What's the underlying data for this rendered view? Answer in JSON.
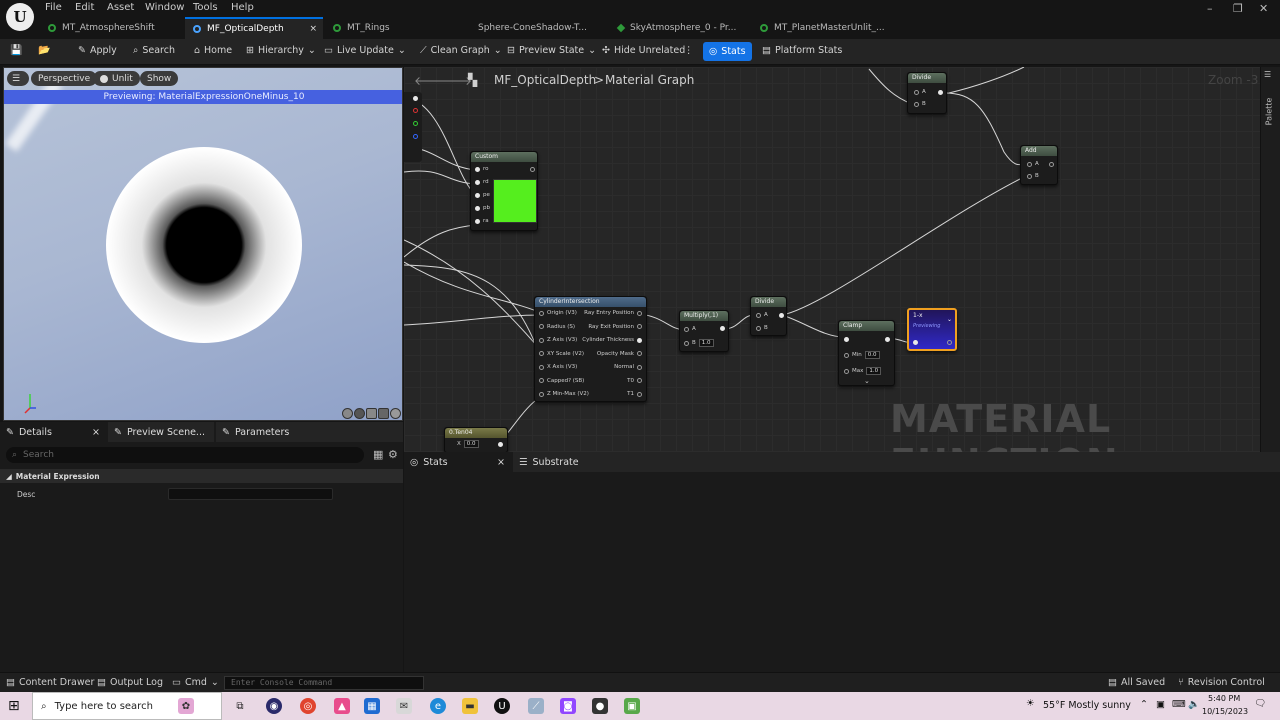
{
  "menu": {
    "items": [
      "File",
      "Edit",
      "Asset",
      "Window",
      "Tools",
      "Help"
    ]
  },
  "tabs": [
    {
      "label": "MT_AtmosphereShift"
    },
    {
      "label": "MF_OpticalDepth",
      "close": "×"
    },
    {
      "label": "MT_Rings"
    },
    {
      "label": "Sphere-ConeShadow-T..."
    },
    {
      "label": "SkyAtmosphere_0 - Pr..."
    },
    {
      "label": "MT_PlanetMasterUnlit_..."
    }
  ],
  "toolbar": {
    "apply": "Apply",
    "search": "Search",
    "home": "Home",
    "hierarchy": "Hierarchy",
    "live_update": "Live Update",
    "clean_graph": "Clean Graph",
    "preview_state": "Preview State",
    "hide_unrelated": "Hide Unrelated",
    "stats": "Stats",
    "platform_stats": "Platform Stats"
  },
  "viewport": {
    "perspective": "Perspective",
    "unlit": "Unlit",
    "show": "Show",
    "previewing": "Previewing: MaterialExpressionOneMinus_10"
  },
  "details": {
    "tabs": [
      "Details",
      "Preview Scene...",
      "Parameters"
    ],
    "search_placeholder": "Search",
    "section": "Material Expression",
    "desc_label": "Desc"
  },
  "graph": {
    "breadcrumb_root": "MF_OpticalDepth",
    "breadcrumb_sep": ">",
    "breadcrumb_leaf": "Material Graph",
    "zoom": "Zoom -3",
    "watermark": "MATERIAL FUNCTION",
    "palette": "Palette",
    "nodes": {
      "divide_top": {
        "title": "Divide",
        "a": "A",
        "b": "B"
      },
      "add": {
        "title": "Add",
        "a": "A",
        "b": "B"
      },
      "custom": {
        "title": "Custom",
        "pins": [
          "ro",
          "rd",
          "pe",
          "pb",
          "ra"
        ],
        "preview_color": "#55ee1e"
      },
      "cyl": {
        "title": "CylinderIntersection",
        "inputs": [
          "Origin (V3)",
          "Radius (S)",
          "Z Axis (V3)",
          "XY Scale (V2)",
          "X Axis (V3)",
          "Capped? (SB)",
          "Z Min-Max (V2)"
        ],
        "outputs": [
          "Ray Entry Position",
          "Ray Exit Position",
          "Cylinder Thickness",
          "Opacity Mask",
          "Normal",
          "T0",
          "T1"
        ]
      },
      "multiply": {
        "title": "Multiply(,1)",
        "a": "A",
        "b": "B",
        "b_val": "1.0"
      },
      "divide_mid": {
        "title": "Divide",
        "a": "A",
        "b": "B"
      },
      "clamp": {
        "title": "Clamp",
        "min": "Min",
        "min_val": "0.0",
        "max": "Max",
        "max_val": "1.0"
      },
      "oneminus": {
        "title": "1-x",
        "previewing": "Previewing"
      },
      "scalar": {
        "title": "0.Ten04",
        "x": "X",
        "x_val": "0.0"
      }
    }
  },
  "bottom_panel": {
    "stats_tab": "Stats",
    "substrate_tab": "Substrate",
    "close": "×"
  },
  "statusbar": {
    "content_drawer": "Content Drawer",
    "output_log": "Output Log",
    "cmd": "Cmd",
    "console_placeholder": "Enter Console Command",
    "all_saved": "All Saved",
    "revision_control": "Revision Control"
  },
  "taskbar": {
    "search": "Type here to search",
    "weather": "55°F  Mostly sunny",
    "time": "5:40 PM",
    "date": "10/15/2023"
  },
  "colors": {
    "accent": "#1473e6",
    "preview_bar": "#4661e0",
    "green_preview": "#55ee1e"
  }
}
